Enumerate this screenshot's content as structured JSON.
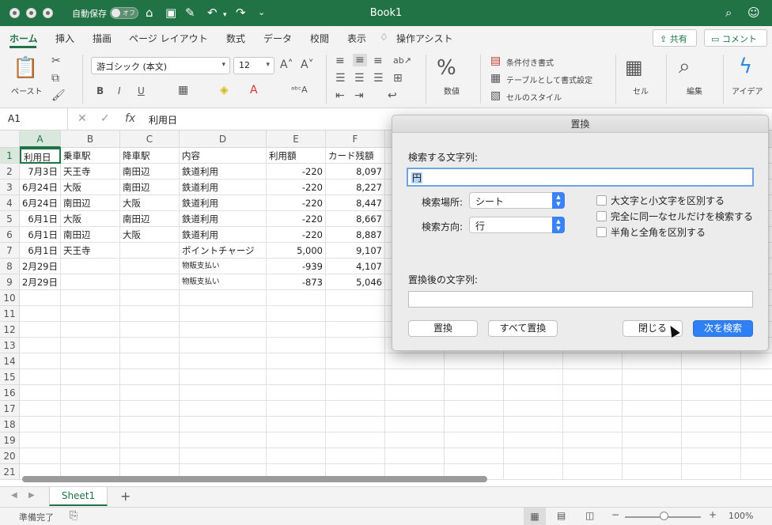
{
  "titlebar": {
    "autosave_label": "自動保存",
    "autosave_state": "オフ",
    "doc_title": "Book1",
    "icons": [
      "home-icon",
      "save-icon",
      "edit-icon",
      "undo-icon",
      "redo-icon",
      "more-icon",
      "search-icon",
      "account-icon"
    ]
  },
  "ribbon_tabs": [
    "ホーム",
    "挿入",
    "描画",
    "ページ レイアウト",
    "数式",
    "データ",
    "校閲",
    "表示",
    "操作アシスト"
  ],
  "ribbon_buttons": {
    "share": "共有",
    "comment": "コメント"
  },
  "ribbon": {
    "paste": "ペースト",
    "font_name": "游ゴシック (本文)",
    "font_size": "12",
    "number_label": "数値",
    "conditional_format": "条件付き書式",
    "format_as_table": "テーブルとして書式設定",
    "cell_styles": "セルのスタイル",
    "cells_label": "セル",
    "edit_label": "編集",
    "ideas_label": "アイデア",
    "bold": "B",
    "italic": "I",
    "underline": "U"
  },
  "formula_bar": {
    "name_box": "A1",
    "fx": "fx",
    "content": "利用日"
  },
  "columns": [
    "A",
    "B",
    "C",
    "D",
    "E",
    "F"
  ],
  "rows": [
    "1",
    "2",
    "3",
    "4",
    "5",
    "6",
    "7",
    "8",
    "9",
    "10",
    "11",
    "12",
    "13",
    "14",
    "15",
    "16",
    "17",
    "18",
    "19",
    "20",
    "21"
  ],
  "table": [
    [
      "利用日",
      "乗車駅",
      "降車駅",
      "内容",
      "利用額",
      "カード残額"
    ],
    [
      "7月3日",
      "天王寺",
      "南田辺",
      "鉄道利用",
      "-220",
      "8,097"
    ],
    [
      "6月24日",
      "大阪",
      "南田辺",
      "鉄道利用",
      "-220",
      "8,227"
    ],
    [
      "6月24日",
      "南田辺",
      "大阪",
      "鉄道利用",
      "-220",
      "8,447"
    ],
    [
      "6月1日",
      "大阪",
      "南田辺",
      "鉄道利用",
      "-220",
      "8,667"
    ],
    [
      "6月1日",
      "南田辺",
      "大阪",
      "鉄道利用",
      "-220",
      "8,887"
    ],
    [
      "6月1日",
      "天王寺",
      "",
      "ポイントチャージ",
      "5,000",
      "9,107"
    ],
    [
      "2月29日",
      "",
      "",
      "物販支払い",
      "-939",
      "4,107"
    ],
    [
      "2月29日",
      "",
      "",
      "物販支払い",
      "-873",
      "5,046"
    ]
  ],
  "sheet": {
    "tab": "Sheet1",
    "add": "+"
  },
  "status": {
    "ready": "準備完了",
    "zoom": "100%"
  },
  "dialog": {
    "title": "置換",
    "find_label": "検索する文字列:",
    "find_value": "円",
    "search_in_label": "検索場所:",
    "search_in_value": "シート",
    "direction_label": "検索方向:",
    "direction_value": "行",
    "opt_case": "大文字と小文字を区別する",
    "opt_whole": "完全に同一なセルだけを検索する",
    "opt_width": "半角と全角を区別する",
    "replace_label": "置換後の文字列:",
    "replace_value": "",
    "btn_replace": "置換",
    "btn_replace_all": "すべて置換",
    "btn_close": "閉じる",
    "btn_find_next": "次を検索"
  }
}
